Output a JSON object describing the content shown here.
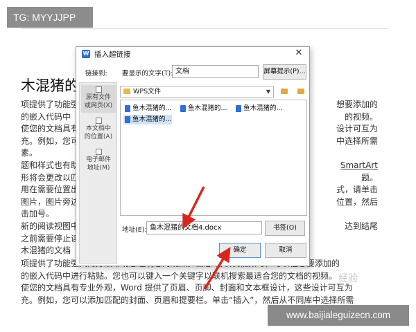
{
  "watermarks": {
    "tg": "TG: MYYJJPP",
    "site": "www.baijialeguizecn.com",
    "faint": "经验"
  },
  "document": {
    "title": "木混猪的",
    "lines": [
      {
        "left": "项提供了功能强",
        "right": "想要添加的"
      },
      {
        "left": "的嵌入代码中",
        "right": "的视频。"
      },
      {
        "left": "使您的文档具有",
        "right": "设计可互为"
      },
      {
        "left": "充。例如，您可",
        "right": "中选择所需"
      },
      {
        "left": "素。",
        "right": ""
      },
      {
        "left": "题和样式也有助",
        "right": "SmartArt"
      },
      {
        "left": "形将会更改以匹",
        "right": "题。"
      },
      {
        "left": "用在需要位置出",
        "right": "式，请单击"
      },
      {
        "left": "图片，图片旁边",
        "right": "位置，然后"
      },
      {
        "left": "击加号。",
        "right": ""
      },
      {
        "left": "新的阅读视图中",
        "right": "达到结尾"
      },
      {
        "left": "之前需要停止读",
        "right": ""
      },
      {
        "left": "木混猪的文档",
        "right": ""
      }
    ],
    "bottom_lines": [
      "项提供了功能强大的方法帮助您证明您的观点。当您    击联机视频时，可以在想要添加的",
      "的嵌入代码中进行粘贴。您也可以键入一个关键字以联机搜索最适合您的文档的视频。",
      "使您的文档具有专业外观，Word 提供了页眉、页脚、封面和文本框设计，这些设计可互为",
      "充。例如，您可以添加匹配的封面、页眉和提要栏。单击“插入”，然后从不同库中选择所需"
    ]
  },
  "dialog": {
    "title": "插入超链接",
    "close_icon": "close-icon",
    "link_to_label": "链接到:",
    "display_text_label": "要显示的文字(T):",
    "display_text_value": "文档",
    "screentip_button": "屏幕提示(P)...",
    "nav": [
      {
        "label": "原有文件\n或网页(X)",
        "icon": "file-web-icon",
        "active": true
      },
      {
        "label": "本文档中\n的位置(A)",
        "icon": "document-place-icon",
        "active": false
      },
      {
        "label": "电子邮件\n地址(M)",
        "icon": "email-icon",
        "active": false
      }
    ],
    "folder": "WPS文件",
    "files": [
      {
        "name": "鱼木混猪的...",
        "selected": false
      },
      {
        "name": "鱼木混猪的...",
        "selected": false
      },
      {
        "name": "鱼木混猪的...",
        "selected": false
      },
      {
        "name": "鱼木混猪的...",
        "selected": true
      }
    ],
    "address_label": "地址(E):",
    "address_value": "鱼木混猪的文档4.docx",
    "bookmark_button": "书签(O)",
    "ok_button": "确定",
    "cancel_button": "取消"
  },
  "colors": {
    "annotation_arrow": "#d9261c",
    "selection": "#cfe3f7",
    "badge_gray": "#8d8d8d"
  }
}
